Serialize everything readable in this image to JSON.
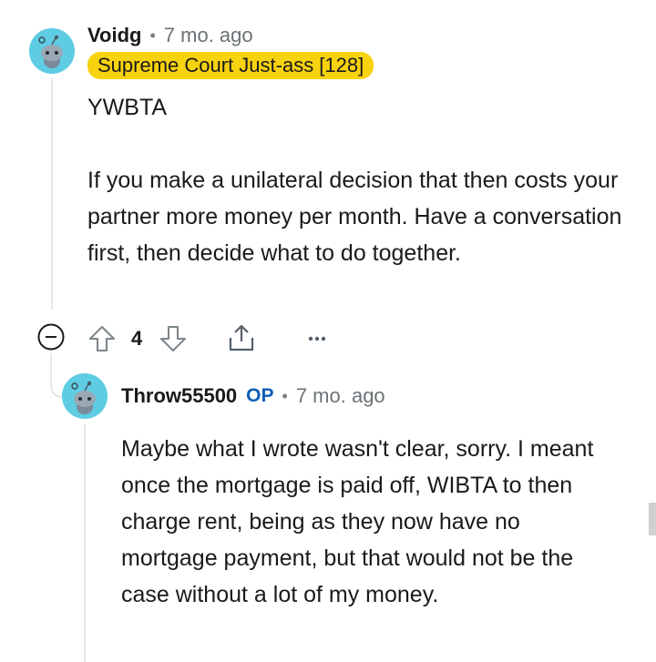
{
  "comment": {
    "username": "Voidg",
    "separator": "•",
    "time": "7 mo. ago",
    "flair": "Supreme Court Just-ass [128]",
    "paragraph_1": "YWBTA",
    "paragraph_2": "If you make a unilateral decision that then costs your partner more money per month. Have a conversation first, then decide what to do together.",
    "vote_count": "4",
    "avatar_color": "#5ecde3"
  },
  "reply": {
    "username": "Throw55500",
    "op_badge": "OP",
    "separator": "•",
    "time": "7 mo. ago",
    "body": "Maybe what I wrote wasn't clear, sorry. I meant once the mortgage is paid off, WIBTA to then charge rent, being as they now have no mortgage payment, but that would not be the case without a lot of my money.",
    "avatar_color": "#5ecde3"
  },
  "colors": {
    "flair_bg": "#f7d20e",
    "op_blue": "#0d5fb7",
    "thread_line": "#e8e8e8"
  },
  "icons": [
    "collapse-icon",
    "upvote-icon",
    "downvote-icon",
    "share-icon",
    "more-icon"
  ]
}
